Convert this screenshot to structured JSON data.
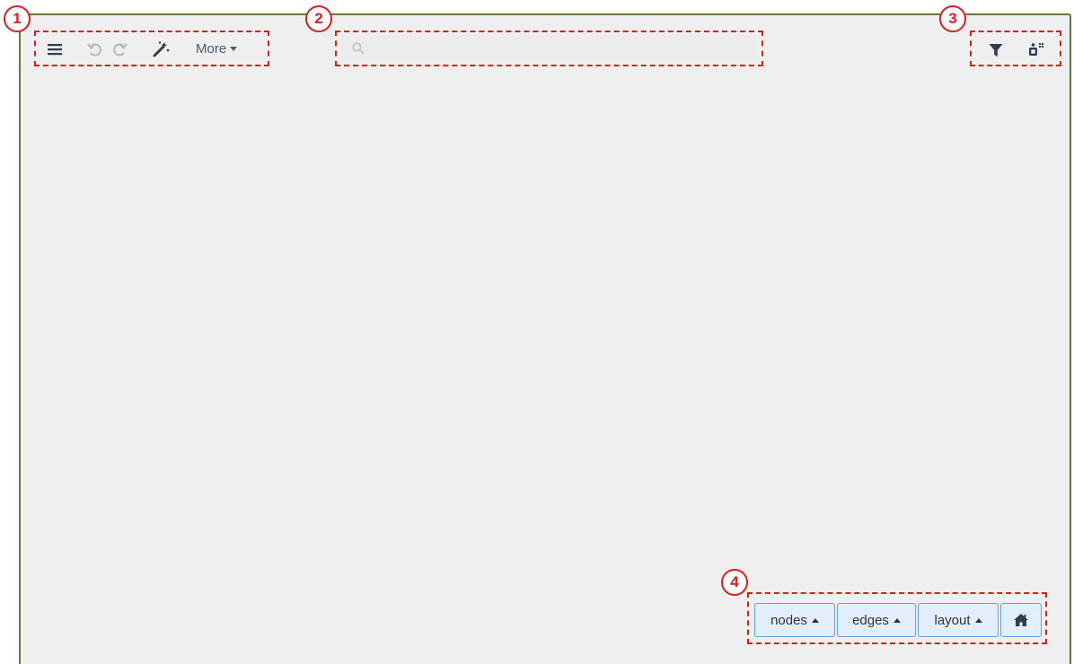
{
  "callouts": [
    "1",
    "2",
    "3",
    "4"
  ],
  "toolbar": {
    "more_label": "More",
    "icons": [
      "menu-icon",
      "undo-icon",
      "redo-icon",
      "magic-wand-icon",
      "caret-down-icon"
    ]
  },
  "search": {
    "placeholder": "",
    "value": ""
  },
  "right_tools": {
    "icons": [
      "filter-icon",
      "node-grid-icon"
    ]
  },
  "bottom_controls": {
    "nodes_label": "nodes",
    "edges_label": "edges",
    "layout_label": "layout",
    "icons": [
      "caret-up-icon",
      "home-icon"
    ]
  },
  "colors": {
    "canvas_bg": "#efefef",
    "canvas_border": "#5f7a3c",
    "annotation_red": "#e01b1b",
    "button_border": "#5da2f0",
    "button_bg": "#e3eefc",
    "icon_dark": "#2c3e50"
  }
}
